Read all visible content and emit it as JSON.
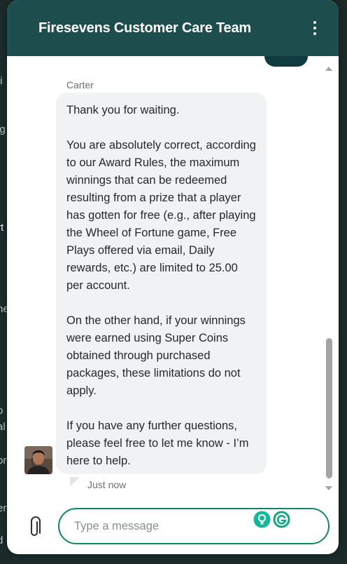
{
  "colors": {
    "header_bg": "#1d4d4d",
    "input_border": "#13875e",
    "bubble_bg": "#f1f2f4",
    "page_bg": "#1b2b2a"
  },
  "header": {
    "title": "Firesevens Customer Care Team",
    "menu_icon": "kebab-menu-icon"
  },
  "background_fragments": [
    "ti",
    "ig",
    "t",
    "rt",
    "ne",
    "o",
    "al",
    "or",
    "er",
    "d"
  ],
  "conversation": {
    "sender": "Carter",
    "message_paragraphs": [
      "Thank you for waiting.",
      "You are absolutely correct, according to our Award Rules, the maximum winnings that can be redeemed resulting from a prize that a player has gotten for free (e.g., after playing the Wheel of Fortune game, Free Plays offered via email, Daily rewards, etc.) are limited to 25.00 per account.",
      "On the other hand, if your winnings were earned using Super Coins obtained through purchased packages, these limitations do not apply.",
      "If you have any further questions, please feel free to let me know - I’m here to help."
    ],
    "timestamp": "Just now"
  },
  "composer": {
    "placeholder": "Type a message",
    "attach_icon": "paperclip-icon",
    "extension_icons": [
      "lightbulb-icon",
      "grammarly-icon"
    ]
  }
}
